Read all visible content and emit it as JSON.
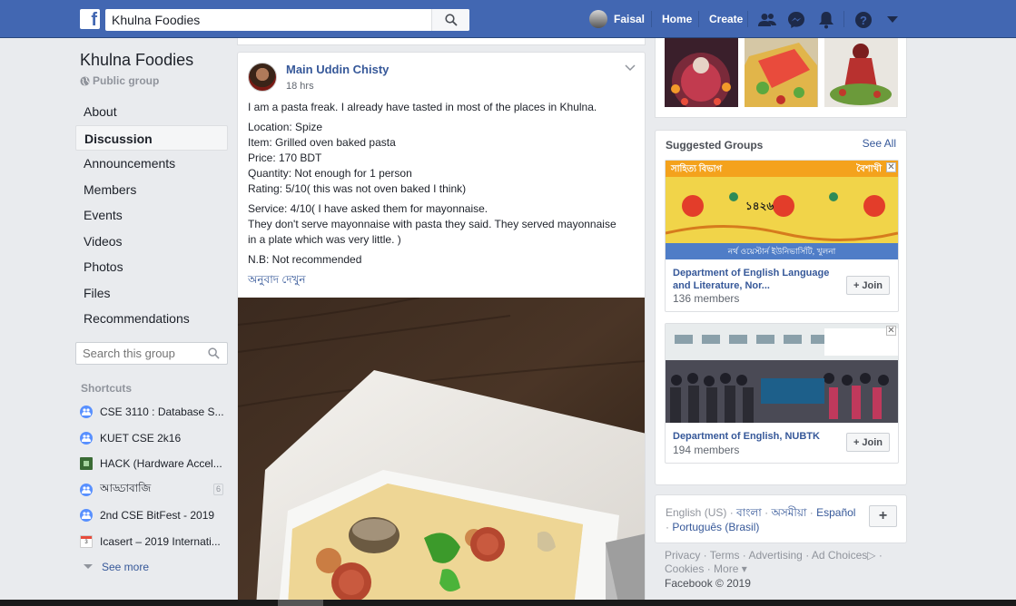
{
  "topbar": {
    "search_value": "Khulna Foodies",
    "user_name": "Faisal",
    "home_label": "Home",
    "create_label": "Create",
    "brand_color": "#4267b2"
  },
  "group": {
    "title": "Khulna Foodies",
    "privacy": "Public group"
  },
  "sidebar": {
    "items": [
      {
        "label": "About"
      },
      {
        "label": "Discussion"
      },
      {
        "label": "Announcements"
      },
      {
        "label": "Members"
      },
      {
        "label": "Events"
      },
      {
        "label": "Videos"
      },
      {
        "label": "Photos"
      },
      {
        "label": "Files"
      },
      {
        "label": "Recommendations"
      }
    ],
    "search_placeholder": "Search this group",
    "shortcuts_heading": "Shortcuts",
    "shortcuts": [
      {
        "label": "CSE 3110 : Database S...",
        "icon": "group-icon"
      },
      {
        "label": "KUET CSE 2k16",
        "icon": "group-icon"
      },
      {
        "label": "HACK (Hardware Accel...",
        "icon": "page-icon"
      },
      {
        "label": "আড্ডাবাজি",
        "icon": "group-icon",
        "badge": "6"
      },
      {
        "label": "2nd CSE BitFest - 2019",
        "icon": "group-icon"
      },
      {
        "label": "Icasert – 2019 Internati...",
        "icon": "calendar-icon",
        "icon_text": "3"
      }
    ],
    "see_more": "See more"
  },
  "post": {
    "author": "Main Uddin Chisty",
    "time": "18 hrs",
    "paragraphs": [
      [
        "I am a pasta freak. I already have tasted in most of the places in Khulna."
      ],
      [
        "Location: Spize",
        "Item: Grilled oven baked pasta",
        "Price: 170 BDT",
        "Quantity: Not enough for 1 person",
        "Rating: 5/10( this was not oven baked I think)"
      ],
      [
        "Service: 4/10( I have asked them for mayonnaise.",
        "They don't serve mayonnaise with pasta they said. They served mayonnaise",
        "in a plate which was very little. )"
      ],
      [
        "N.B: Not recommended"
      ]
    ],
    "translate_label": "অনুবাদ দেখুন"
  },
  "suggested": {
    "title": "Suggested Groups",
    "see_all": "See All",
    "groups": [
      {
        "name": "Department of English Language and Literature, Nor...",
        "members": "136 members",
        "join": "Join",
        "banner_top_left": "সাহিত্য বিভাগ",
        "banner_top_right": "বৈশাখী",
        "banner_bottom": "নর্থ ওয়েস্টার্ন ইউনিভার্সিটি, খুলনা",
        "banner_year": "১৪২৬"
      },
      {
        "name": "Department of English, NUBTK",
        "members": "194 members",
        "join": "Join"
      }
    ]
  },
  "languages": {
    "items": [
      "English (US)",
      "বাংলা",
      "অসমীয়া",
      "Español",
      "Português (Brasil)"
    ]
  },
  "footer": {
    "links": [
      "Privacy",
      "Terms",
      "Advertising",
      "Ad Choices",
      "Cookies",
      "More"
    ],
    "copyright": "Facebook © 2019"
  }
}
